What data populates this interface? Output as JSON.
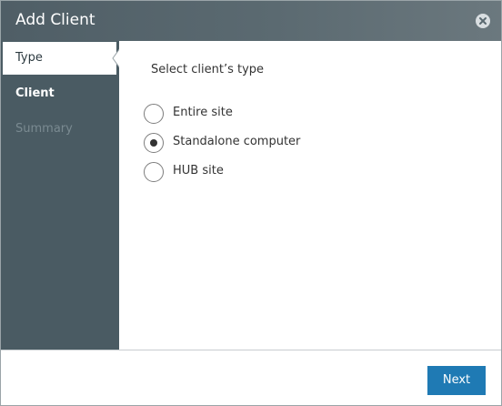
{
  "dialog": {
    "title": "Add Client",
    "close_icon": "close-circle-icon"
  },
  "steps": [
    {
      "label": "Type",
      "state": "active"
    },
    {
      "label": "Client",
      "state": "upcoming"
    },
    {
      "label": "Summary",
      "state": "disabled"
    }
  ],
  "content": {
    "prompt": "Select client’s type",
    "options": [
      {
        "label": "Entire site",
        "selected": false
      },
      {
        "label": "Standalone computer",
        "selected": true
      },
      {
        "label": "HUB site",
        "selected": false
      }
    ]
  },
  "footer": {
    "next_label": "Next"
  },
  "colors": {
    "sidebar": "#4a5b63",
    "accent_button": "#1f7ab4",
    "titlebar": "#56656c"
  }
}
